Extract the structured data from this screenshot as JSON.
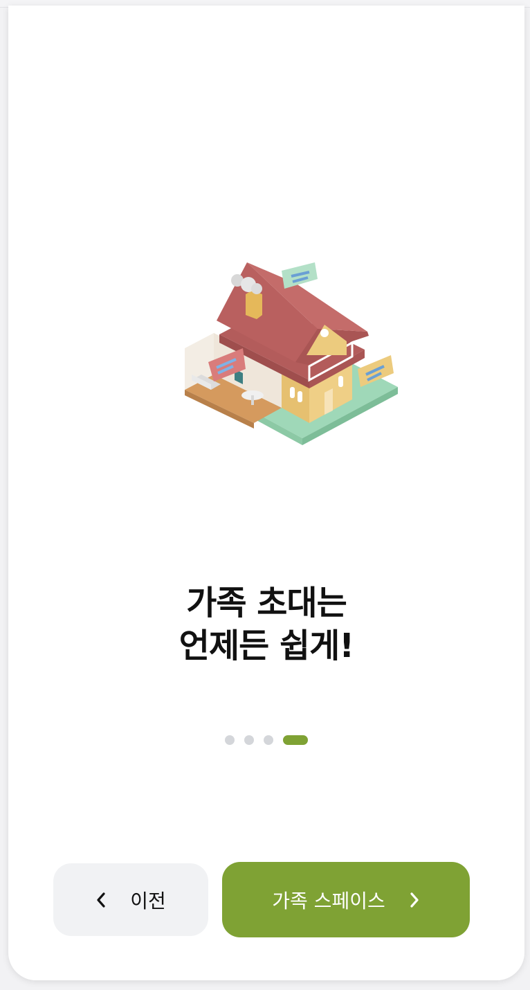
{
  "onboarding": {
    "headline_line1": "가족 초대는",
    "headline_line2": "언제든 쉽게!",
    "pages_total": 4,
    "current_page": 4
  },
  "nav": {
    "prev_label": "이전",
    "next_label": "가족 스페이스",
    "prev_icon": "chevron-left-icon",
    "next_icon": "chevron-right-icon"
  },
  "colors": {
    "accent": "#7fa234",
    "dot_inactive": "#d4d6da",
    "prev_button_bg": "#f1f2f4",
    "roof": "#b9605f",
    "wall": "#eccb7e",
    "lawn": "#a6dcbf"
  },
  "illustration": "house-icon"
}
